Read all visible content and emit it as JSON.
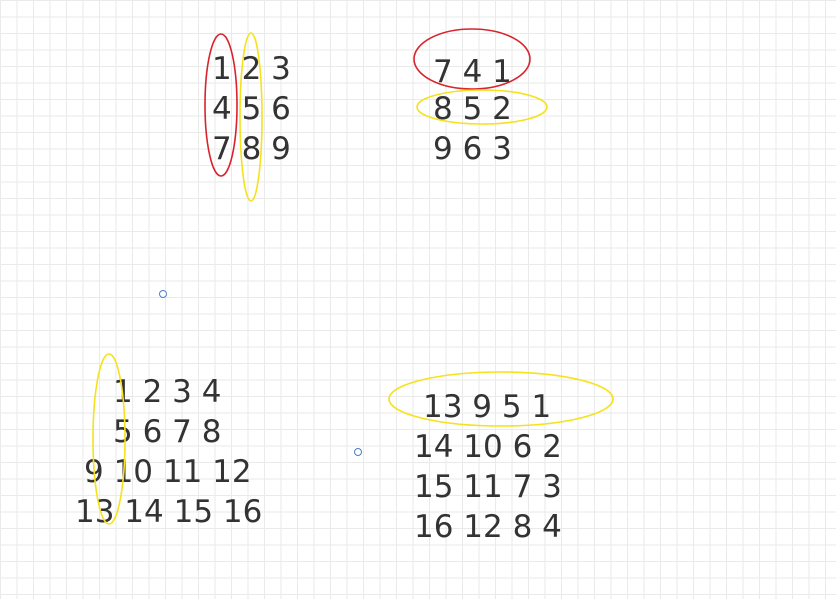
{
  "colors": {
    "grid": "#eaeaea",
    "text": "#333333",
    "highlight_red": "#d9232d",
    "highlight_yellow": "#f5e21a",
    "handle": "#4a7fcf"
  },
  "matrices": {
    "m3_original": {
      "rows": [
        "1 2 3",
        "4 5 6",
        "7 8 9"
      ]
    },
    "m3_rotated": {
      "rows": [
        "7 4 1",
        "8 5 2",
        "9 6 3"
      ]
    },
    "m4_original": {
      "rows": [
        "1 2 3 4",
        "5 6 7 8",
        "9 10 11 12",
        "13 14 15 16"
      ]
    },
    "m4_rotated": {
      "rows": [
        "13 9 5 1",
        "14 10 6 2",
        "15 11 7 3",
        "16 12 8 4"
      ]
    }
  }
}
